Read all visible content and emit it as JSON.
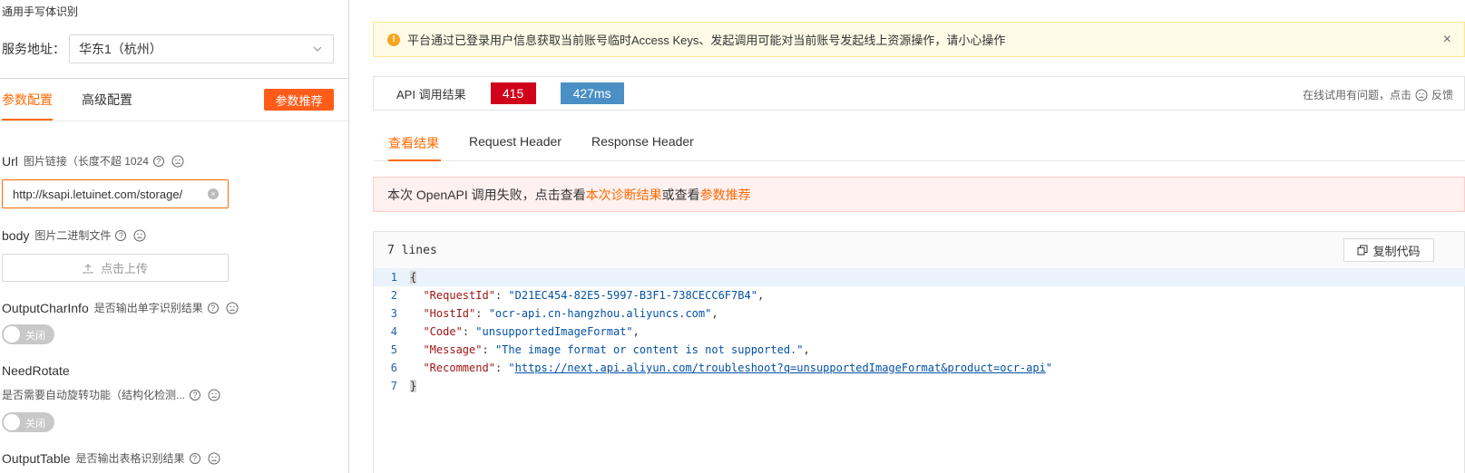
{
  "left": {
    "api_name": "通用手写体识别",
    "region": {
      "label": "服务地址：",
      "value": "华东1（杭州）"
    },
    "tabs": [
      {
        "label": "参数配置"
      },
      {
        "label": "高级配置"
      }
    ],
    "recommend_button": "参数推荐",
    "params": [
      {
        "name": "Url",
        "desc": "图片链接（长度不超 1024"
      },
      {
        "name": "body",
        "desc": "图片二进制文件"
      },
      {
        "name": "OutputCharInfo",
        "desc": "是否输出单字识别结果"
      },
      {
        "name": "NeedRotate",
        "desc": "是否需要自动旋转功能（结构化检测..."
      },
      {
        "name": "OutputTable",
        "desc": "是否输出表格识别结果"
      }
    ],
    "url_value": "http://ksapi.letuinet.com/storage/",
    "upload_label": "点击上传",
    "toggle_off": "关闭"
  },
  "right": {
    "alert": "平台通过已登录用户信息获取当前账号临时Access Keys、发起调用可能对当前账号发起线上资源操作，请小心操作",
    "result": {
      "label": "API 调用结果",
      "code": "415",
      "time": "427ms",
      "feedback_text": "在线试用有问题，点击",
      "feedback_link": "反馈"
    },
    "tabs": [
      {
        "label": "查看结果"
      },
      {
        "label": "Request Header"
      },
      {
        "label": "Response Header"
      }
    ],
    "error": {
      "prefix": "本次 OpenAPI 调用失败，点击查看",
      "link1": "本次诊断结果",
      "middle": "或查看",
      "link2": "参数推荐"
    },
    "code": {
      "line_count_label": "7 lines",
      "copy_label": "复制代码",
      "line_numbers": [
        "1",
        "2",
        "3",
        "4",
        "5",
        "6",
        "7"
      ],
      "open_brace": "{",
      "close_brace": "}",
      "fields": [
        {
          "key": "\"RequestId\"",
          "value": "\"D21EC454-82E5-5997-B3F1-738CECC6F7B4\""
        },
        {
          "key": "\"HostId\"",
          "value": "\"ocr-api.cn-hangzhou.aliyuncs.com\""
        },
        {
          "key": "\"Code\"",
          "value": "\"unsupportedImageFormat\""
        },
        {
          "key": "\"Message\"",
          "value": "\"The image format or content is not supported.\""
        },
        {
          "key": "\"Recommend\"",
          "value": "https://next.api.aliyun.com/troubleshoot?q=unsupportedImageFormat&product=ocr-api"
        }
      ]
    }
  }
}
